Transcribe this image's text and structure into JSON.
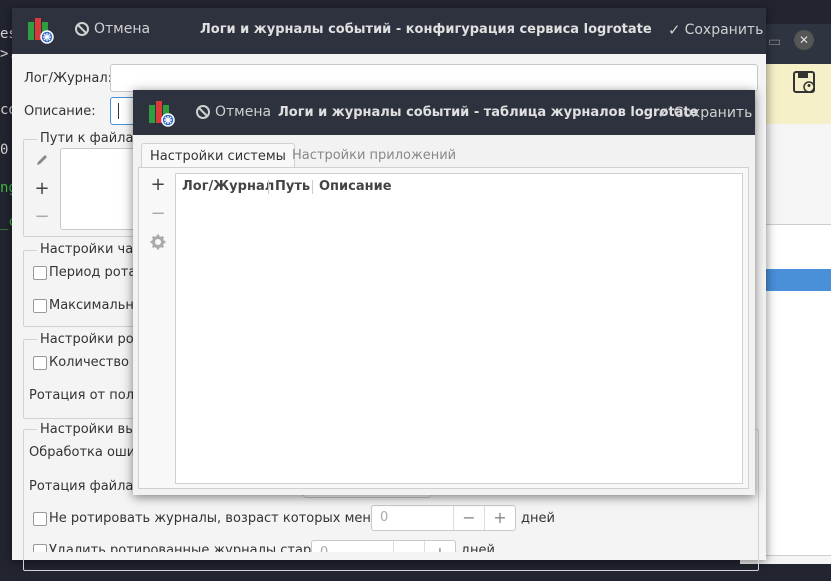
{
  "background": {
    "terminal_fragments": [
      "es",
      ">.",
      "co",
      "0",
      "ng",
      "_c"
    ]
  },
  "main_window": {
    "cancel_label": "Отмена",
    "title": "Логи и журналы событий - конфигурация сервиса logrotate",
    "save_label": "Сохранить",
    "log_label": "Лог/Журнал:",
    "log_value": "",
    "description_label": "Описание:",
    "paths_group_title": "Пути к файлам",
    "frequency_group_title": "Настройки част",
    "rotation_period_label": "Период ротаци",
    "max_label": "Максимальн",
    "rotation_group_title": "Настройки рот",
    "file_count_label": "Количество ф",
    "rotation_user_label": "Ротация от поль",
    "choice_group_title": "Настройки выб",
    "error_handling_label": "Обработка ошиб",
    "rotate_file_label": "Ротация файла ж",
    "no_rotate_label": "Не ротировать журналы, возраст которых меньше",
    "no_rotate_value": "0",
    "days_label": "дней",
    "delete_label": "Удалить ротированные журналы старше",
    "delete_value": "0",
    "days_label2": "дней"
  },
  "dialog": {
    "cancel_label": "Отмена",
    "title": "Логи и журналы событий - таблица журналов logrotate",
    "save_label": "Сохранить",
    "tabs": [
      {
        "label": "Настройки системы",
        "active": true
      },
      {
        "label": "Настройки приложений",
        "active": false
      }
    ],
    "columns": [
      "Лог/Журнал",
      "Путь",
      "Описание"
    ]
  }
}
